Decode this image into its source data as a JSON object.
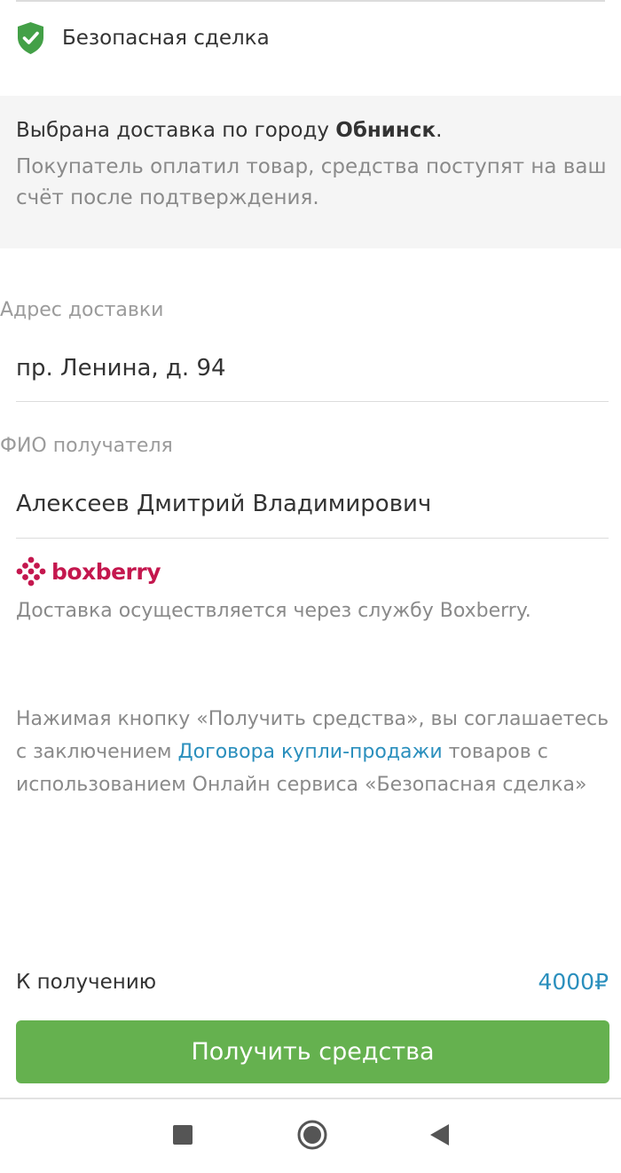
{
  "header": {
    "safe_deal_title": "Безопасная сделка"
  },
  "info": {
    "delivery_prefix": "Выбрана доставка по городу ",
    "city": "Обнинск",
    "delivery_suffix": ".",
    "payment_note": "Покупатель оплатил товар, средства поступят на ваш счёт после подтверждения."
  },
  "address": {
    "label": "Адрес доставки",
    "value": "пр. Ленина, д. 94"
  },
  "recipient": {
    "label": "ФИО получателя",
    "value": "Алексеев Дмитрий Владимирович"
  },
  "carrier": {
    "logo_text": "boxberry",
    "note": "Доставка осуществляется через службу Boxberry.",
    "brand_color": "#c4174e"
  },
  "terms": {
    "line_start": "Нажимая кнопку «Получить средства», вы соглашаетесь с заключением ",
    "link_text": "Договора купли-продажи",
    "line_end": " товаров с использованием Онлайн сервиса «Безопасная сделка»"
  },
  "payout": {
    "label": "К получению",
    "amount": "4000₽"
  },
  "action": {
    "button_label": "Получить средства"
  },
  "colors": {
    "accent_green": "#65b14f",
    "shield_green": "#43a047",
    "link_blue": "#2a8fbd"
  },
  "navbar": {
    "icons": [
      "recents-square-icon",
      "home-circle-icon",
      "back-triangle-icon"
    ]
  }
}
